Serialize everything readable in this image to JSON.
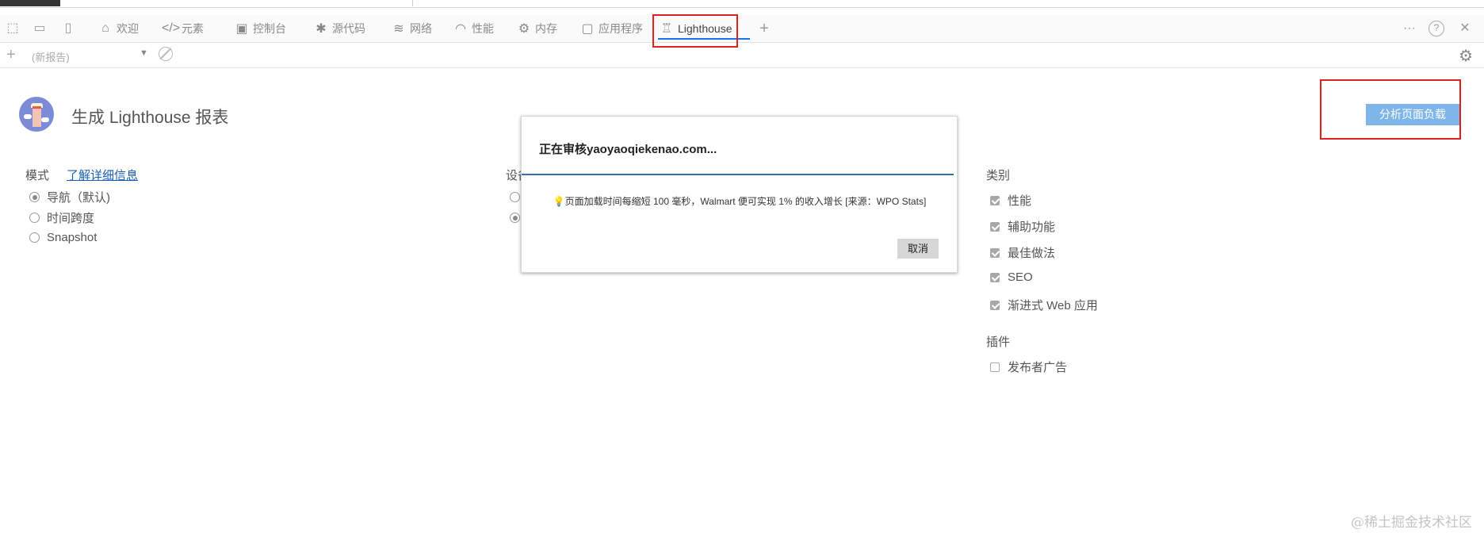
{
  "colors": {
    "accent": "#1a73e8",
    "highlight_box": "#e0201c",
    "analyze_button": "#7eb6ea"
  },
  "toolbar": {
    "left_icons": [
      "inspect-icon",
      "device-icon",
      "dock-icon"
    ],
    "tabs": [
      {
        "label": "欢迎",
        "icon": "home-icon"
      },
      {
        "label": "元素",
        "icon": "code-icon"
      },
      {
        "label": "控制台",
        "icon": "console-icon"
      },
      {
        "label": "源代码",
        "icon": "bug-icon"
      },
      {
        "label": "网络",
        "icon": "wifi-icon"
      },
      {
        "label": "性能",
        "icon": "gauge-icon"
      },
      {
        "label": "内存",
        "icon": "chip-icon"
      },
      {
        "label": "应用程序",
        "icon": "window-icon"
      },
      {
        "label": "Lighthouse",
        "icon": "lighthouse-icon",
        "active": true
      }
    ],
    "add_tab": "+",
    "more": "···",
    "help": "?",
    "close": "✕"
  },
  "subbar": {
    "new_report": "(新报告)"
  },
  "header": {
    "title": "生成 Lighthouse 报表",
    "analyze_button": "分析页面负载"
  },
  "mode": {
    "label": "模式",
    "learn_more": "了解详细信息",
    "options": [
      {
        "label": "导航（默认)",
        "selected": true
      },
      {
        "label": "时间跨度",
        "selected": false
      },
      {
        "label": "Snapshot",
        "selected": false
      }
    ]
  },
  "device": {
    "label": "设备"
  },
  "categories": {
    "label": "类别",
    "items": [
      {
        "label": "性能",
        "checked": true
      },
      {
        "label": "辅助功能",
        "checked": true
      },
      {
        "label": "最佳做法",
        "checked": true
      },
      {
        "label": "SEO",
        "checked": true
      },
      {
        "label": "渐进式 Web 应用",
        "checked": true
      }
    ]
  },
  "plugins": {
    "label": "插件",
    "items": [
      {
        "label": "发布者广告",
        "checked": false
      }
    ]
  },
  "dialog": {
    "title": "正在审核yaoyaoqiekenao.com...",
    "tip": "页面加载时间每缩短 100 毫秒，Walmart 便可实现 1% 的收入增长 [来源：WPO Stats]",
    "cancel": "取消"
  },
  "watermark": "@稀土掘金技术社区"
}
